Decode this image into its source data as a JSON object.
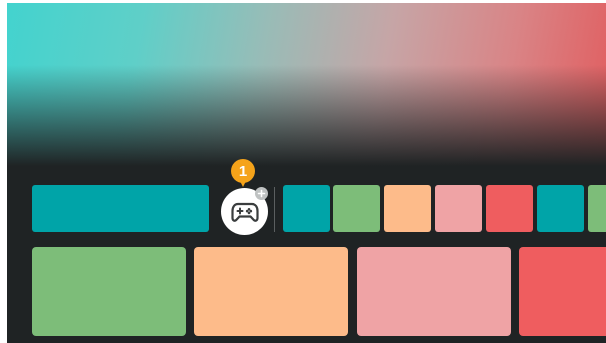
{
  "hero": {
    "gradient_colors": [
      "#43d3ce",
      "#98bcb7",
      "#d98486",
      "#e15d5f"
    ]
  },
  "launcher": {
    "featured_tile_color": "#00a4a8",
    "game_button": {
      "icon": "gamepad-icon",
      "add_icon": "plus-icon"
    },
    "step_marker": {
      "number": "1",
      "color": "#f5a31a"
    },
    "app_tiles": [
      {
        "color": "#00a4a8"
      },
      {
        "color": "#7dbd79"
      },
      {
        "color": "#fdbb8a"
      },
      {
        "color": "#efa3a5"
      },
      {
        "color": "#ef5d5f"
      },
      {
        "color": "#00a4a8"
      },
      {
        "color": "#7dbd79"
      }
    ],
    "cards": [
      {
        "color": "#7dbd79"
      },
      {
        "color": "#fdbb8a"
      },
      {
        "color": "#efa3a5"
      },
      {
        "color": "#ef5d5f"
      }
    ]
  }
}
